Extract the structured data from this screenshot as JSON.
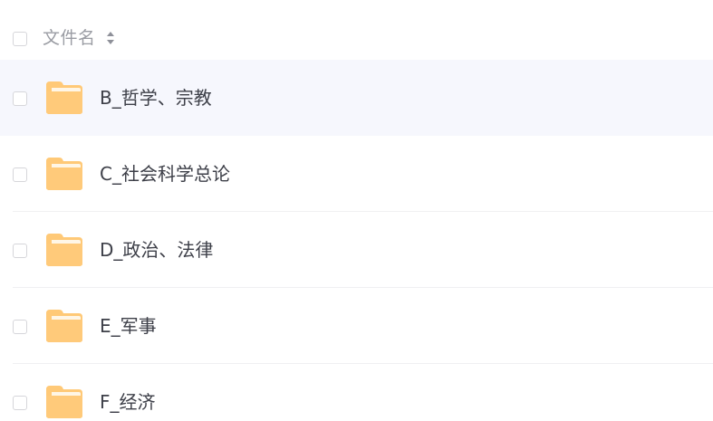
{
  "header": {
    "column_label": "文件名",
    "sort_icon": "sort-icon"
  },
  "files": [
    {
      "name": "B_哲学、宗教",
      "icon": "folder-icon"
    },
    {
      "name": "C_社会科学总论",
      "icon": "folder-icon"
    },
    {
      "name": "D_政治、法律",
      "icon": "folder-icon"
    },
    {
      "name": "E_军事",
      "icon": "folder-icon"
    },
    {
      "name": "F_经济",
      "icon": "folder-icon"
    }
  ],
  "colors": {
    "hover_row_bg": "#f6f7fd",
    "folder_body": "#ffc977",
    "folder_tab": "#ffe0a8"
  }
}
